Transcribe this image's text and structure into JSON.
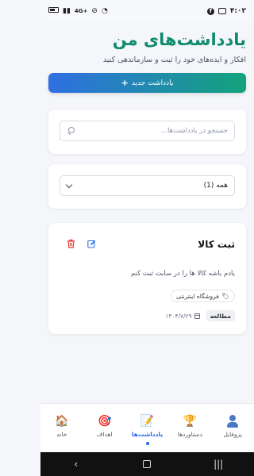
{
  "status_bar": {
    "time": "۴:۰۲",
    "signal_text": "4G+"
  },
  "header": {
    "title": "یادداشت‌های من",
    "subtitle": "افکار و ایده‌های خود را ثبت و سازماندهی کنید",
    "new_note_label": "یادداشت جدید",
    "new_note_plus": "+"
  },
  "search": {
    "placeholder": "جستجو در یادداشت‌ها..."
  },
  "filter": {
    "selected": "همه (1)"
  },
  "notes": [
    {
      "title": "ثبت کالا",
      "body": "یادم باشه کالا ها را در سایت ثبت کنم",
      "tag": "فروشگاه اینترنتی",
      "category": "مطالعه",
      "date": "۱۴۰۴/۷/۲۹"
    }
  ],
  "bottom_nav": {
    "items": [
      {
        "label": "پروفایل",
        "icon": "profile-icon"
      },
      {
        "label": "دستاوردها",
        "icon": "trophy-icon"
      },
      {
        "label": "یادداشت‌ها",
        "icon": "memo-icon",
        "active": true
      },
      {
        "label": "اهداف",
        "icon": "target-icon"
      },
      {
        "label": "خانه",
        "icon": "home-icon"
      }
    ]
  },
  "colors": {
    "title": "#0f8b6e",
    "button_gradient_start": "#13a37c",
    "button_gradient_end": "#2f6fe3",
    "active_nav": "#2563eb",
    "delete": "#e23b3b",
    "edit": "#2f6fe3"
  }
}
